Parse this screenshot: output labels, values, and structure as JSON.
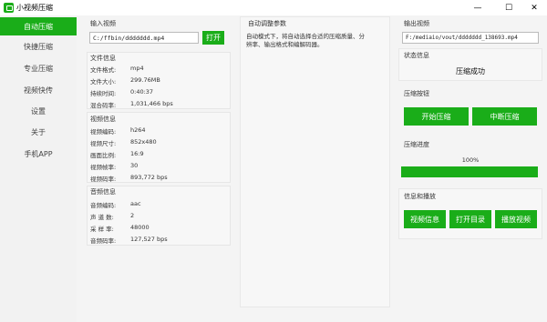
{
  "window": {
    "title": "小视频压缩",
    "controls": {
      "minimize": "—",
      "maximize": "☐",
      "close": "✕"
    }
  },
  "sidebar": {
    "items": [
      {
        "label": "自动压缩",
        "active": true
      },
      {
        "label": "快捷压缩",
        "active": false
      },
      {
        "label": "专业压缩",
        "active": false
      },
      {
        "label": "视频快传",
        "active": false
      },
      {
        "label": "设置",
        "active": false
      },
      {
        "label": "关于",
        "active": false
      },
      {
        "label": "手机APP",
        "active": false
      }
    ]
  },
  "input": {
    "title": "输入视频",
    "path": "C:/ffbin/ddddddd.mp4",
    "open_label": "打开"
  },
  "file_info": {
    "title": "文件信息",
    "rows": [
      {
        "key": "文件格式:",
        "value": "mp4"
      },
      {
        "key": "文件大小:",
        "value": "299.76MB"
      },
      {
        "key": "持续时间:",
        "value": "0:40:37"
      },
      {
        "key": "混合码率:",
        "value": "1,031,466 bps"
      }
    ]
  },
  "video_info": {
    "title": "视频信息",
    "rows": [
      {
        "key": "视频编码:",
        "value": "h264"
      },
      {
        "key": "视频尺寸:",
        "value": "852x480"
      },
      {
        "key": "画面比例:",
        "value": "16:9"
      },
      {
        "key": "视频帧率:",
        "value": "30"
      },
      {
        "key": "视频码率:",
        "value": "893,772 bps"
      }
    ]
  },
  "audio_info": {
    "title": "音频信息",
    "rows": [
      {
        "key": "音频编码:",
        "value": "aac"
      },
      {
        "key": "声 道 数:",
        "value": "2"
      },
      {
        "key": "采 样 率:",
        "value": "48000"
      },
      {
        "key": "音频码率:",
        "value": "127,527 bps"
      }
    ]
  },
  "auto_params": {
    "title": "自动调整参数",
    "description_line1": "自动模式下，将自动选择合适的压缩质量、分",
    "description_line2": "辨率、输出格式和编解码器。"
  },
  "output": {
    "title": "输出视频",
    "path": "F:/mediaio/vout/ddddddd_138693.mp4"
  },
  "status": {
    "title": "状态信息",
    "message": "压缩成功"
  },
  "compress_buttons": {
    "title": "压缩按钮",
    "start_label": "开始压缩",
    "stop_label": "中断压缩"
  },
  "progress": {
    "title": "压缩进度",
    "percent_label": "100%",
    "fraction": 1.0,
    "color": "#1aad19"
  },
  "info_play": {
    "title": "信息和播放",
    "video_info_label": "视频信息",
    "open_dir_label": "打开目录",
    "play_label": "播放视频"
  }
}
